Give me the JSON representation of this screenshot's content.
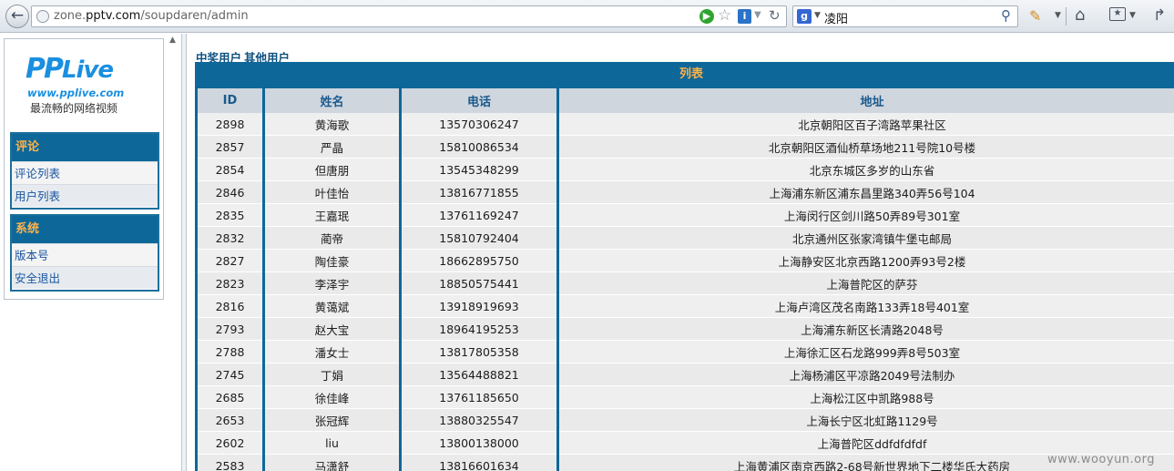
{
  "browser": {
    "url_prefix": "zone.",
    "url_host": "pptv.com",
    "url_path": "/soupdaren/admin",
    "search_text": "凌阳"
  },
  "left_panel": {
    "logo_word_pp": "PP",
    "logo_word_live": "Live",
    "logo_url": "www.pplive.com",
    "logo_slogan": "最流畅的网络视频",
    "groups": [
      {
        "header": "评论",
        "items": [
          "评论列表",
          "用户列表"
        ]
      },
      {
        "header": "系统",
        "items": [
          "版本号",
          "安全退出"
        ]
      }
    ]
  },
  "main": {
    "tab_links": [
      "中奖用户",
      "其他用户"
    ],
    "list_title": "列表",
    "columns": [
      "ID",
      "姓名",
      "电话",
      "地址"
    ],
    "rows": [
      [
        "2898",
        "黄海歌",
        "13570306247",
        "北京朝阳区百子湾路苹果社区"
      ],
      [
        "2857",
        "严晶",
        "15810086534",
        "北京朝阳区酒仙桥草场地211号院10号楼"
      ],
      [
        "2854",
        "但唐朋",
        "13545348299",
        "北京东城区多岁的山东省"
      ],
      [
        "2846",
        "叶佳怡",
        "13816771855",
        "上海浦东新区浦东昌里路340弄56号104"
      ],
      [
        "2835",
        "王嘉珉",
        "13761169247",
        "上海闵行区剑川路50弄89号301室"
      ],
      [
        "2832",
        "蔺帝",
        "15810792404",
        "北京通州区张家湾镇牛堡屯邮局"
      ],
      [
        "2827",
        "陶佳豪",
        "18662895750",
        "上海静安区北京西路1200弄93号2楼"
      ],
      [
        "2823",
        "李泽宇",
        "18850575441",
        "上海普陀区的萨芬"
      ],
      [
        "2816",
        "黄蔼斌",
        "13918919693",
        "上海卢湾区茂名南路133弄18号401室"
      ],
      [
        "2793",
        "赵大宝",
        "18964195253",
        "上海浦东新区长清路2048号"
      ],
      [
        "2788",
        "潘女士",
        "13817805358",
        "上海徐汇区石龙路999弄8号503室"
      ],
      [
        "2745",
        "丁娟",
        "13564488821",
        "上海杨浦区平凉路2049号法制办"
      ],
      [
        "2685",
        "徐佳峰",
        "13761185650",
        "上海松江区中凯路988号"
      ],
      [
        "2653",
        "张冠辉",
        "13880325547",
        "上海长宁区北虹路1129号"
      ],
      [
        "2602",
        "liu",
        "13800138000",
        "上海普陀区ddfdfdfdf"
      ],
      [
        "2583",
        "马潇舒",
        "13816601634",
        "上海黄浦区南京西路2-68号新世界地下二楼华氏大药房"
      ]
    ]
  },
  "watermark": "www.wooyun.org"
}
